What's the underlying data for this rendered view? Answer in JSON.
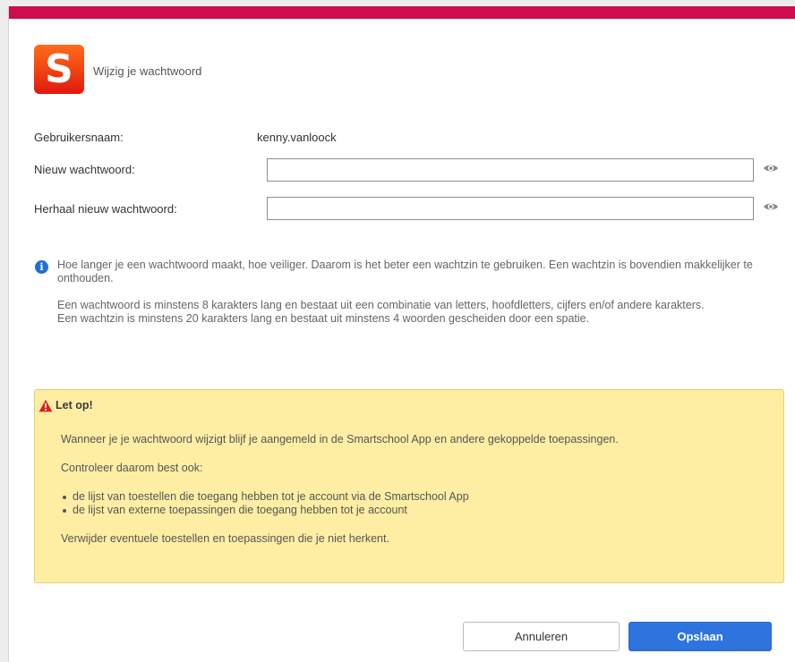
{
  "dialog": {
    "app_logo_letter": "S",
    "title": "Wijzig je wachtwoord",
    "accent_color": "#cc0d4f"
  },
  "form": {
    "username_label": "Gebruikersnaam:",
    "username_value": "kenny.vanloock",
    "new_password_label": "Nieuw wachtwoord:",
    "new_password_value": "",
    "repeat_password_label": "Herhaal nieuw wachtwoord:",
    "repeat_password_value": "",
    "toggle_icon": "eye-icon"
  },
  "info": {
    "icon": "info-icon",
    "paragraph1": "Hoe langer je een wachtwoord maakt, hoe veiliger. Daarom is het beter een wachtzin te gebruiken. Een wachtzin is bovendien makkelijker te onthouden.",
    "paragraph2": "Een wachtwoord is minstens 8 karakters lang en bestaat uit een combinatie van letters, hoofdletters, cijfers en/of andere karakters.",
    "paragraph3": "Een wachtzin is minstens 20 karakters lang en bestaat uit minstens 4 woorden gescheiden door een spatie."
  },
  "warning": {
    "icon": "warning-triangle-icon",
    "title": "Let op!",
    "paragraph1": "Wanneer je je wachtwoord wijzigt blijf je aangemeld in de Smartschool App en andere gekoppelde toepassingen.",
    "paragraph2": "Controleer daarom best ook:",
    "items": [
      "de lijst van toestellen die toegang hebben tot je account via de Smartschool App",
      "de lijst van externe toepassingen die toegang hebben tot je account"
    ],
    "paragraph3": "Verwijder eventuele toestellen en toepassingen die je niet herkent."
  },
  "buttons": {
    "cancel_label": "Annuleren",
    "save_label": "Opslaan",
    "save_color": "#2f73de"
  }
}
